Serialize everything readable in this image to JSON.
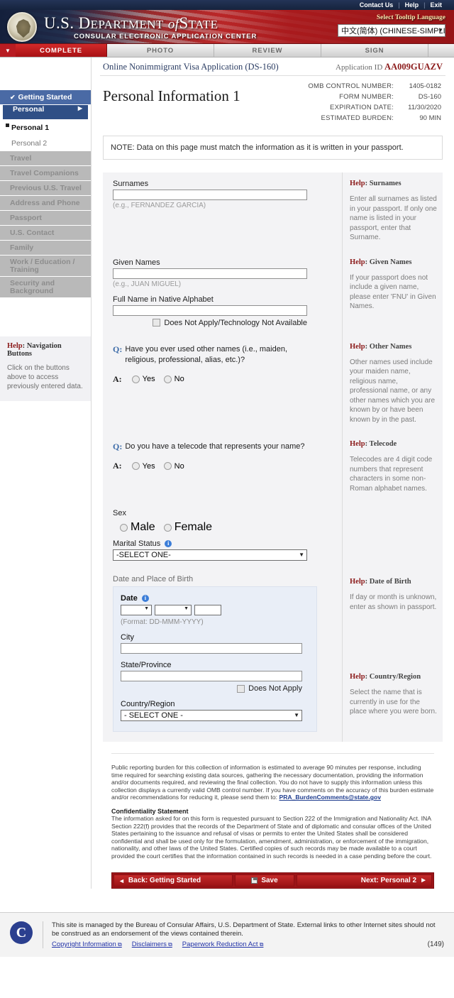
{
  "utility_bar": {
    "links": [
      "Contact Us",
      "Help",
      "Exit"
    ]
  },
  "masthead": {
    "title_us": "U.S. D",
    "title_epartment": "EPARTMENT",
    "title_of": "of",
    "title_s": "S",
    "title_tate": "TATE",
    "subtitle": "CONSULAR ELECTRONIC APPLICATION CENTER",
    "tooltip_language_label": "Select Tooltip Language",
    "tooltip_language_value": "中文(简体)  (CHINESE-SIMPLI",
    "seal_icon": "department-of-state-seal"
  },
  "tabs": [
    {
      "label": "COMPLETE",
      "state": "active"
    },
    {
      "label": "PHOTO",
      "state": "inactive"
    },
    {
      "label": "REVIEW",
      "state": "inactive"
    },
    {
      "label": "SIGN",
      "state": "inactive"
    }
  ],
  "sidebar": {
    "items": [
      {
        "label": "Getting Started",
        "type": "completed",
        "check": "✔"
      },
      {
        "label": "Personal",
        "type": "section",
        "caret": "▶"
      },
      {
        "label": "Personal 1",
        "type": "subitem-current"
      },
      {
        "label": "Personal 2",
        "type": "subitem"
      },
      {
        "label": "Travel",
        "type": "disabled"
      },
      {
        "label": "Travel Companions",
        "type": "disabled"
      },
      {
        "label": "Previous U.S. Travel",
        "type": "disabled"
      },
      {
        "label": "Address and Phone",
        "type": "disabled"
      },
      {
        "label": "Passport",
        "type": "disabled"
      },
      {
        "label": "U.S. Contact",
        "type": "disabled"
      },
      {
        "label": "Family",
        "type": "disabled"
      },
      {
        "label": "Work / Education / Training",
        "type": "disabled-two-line"
      },
      {
        "label": "Security and Background",
        "type": "disabled-two-line"
      }
    ],
    "help": {
      "title_word": "Help",
      "title_rest": ": Navigation Buttons",
      "body": "Click on the buttons above to access previously entered data."
    }
  },
  "header": {
    "app_name": "Online Nonimmigrant Visa Application (DS-160)",
    "application_id_label": "Application ID",
    "application_id": "AA009GUAZV",
    "page_title": "Personal Information 1",
    "omb": [
      {
        "label": "OMB CONTROL NUMBER:",
        "value": "1405-0182"
      },
      {
        "label": "FORM NUMBER:",
        "value": "DS-160"
      },
      {
        "label": "EXPIRATION DATE:",
        "value": "11/30/2020"
      },
      {
        "label": "ESTIMATED BURDEN:",
        "value": "90 MIN"
      }
    ]
  },
  "note": "NOTE: Data on this page must match the information as it is written in your passport.",
  "form": {
    "surnames": {
      "label": "Surnames",
      "value": "",
      "hint": "(e.g., FERNANDEZ GARCIA)",
      "help_title_word": "Help",
      "help_title_rest": ": Surnames",
      "help_text": "Enter all surnames as listed in your passport. If only one name is listed in your passport, enter that Surname."
    },
    "given_names": {
      "label": "Given Names",
      "value": "",
      "hint": "(e.g., JUAN MIGUEL)",
      "help_title_word": "Help",
      "help_title_rest": ": Given Names",
      "help_text": "If your passport does not include a given name, please enter 'FNU' in Given Names."
    },
    "native_alphabet": {
      "label": "Full Name in Native Alphabet",
      "value": "",
      "checkbox_label": "Does Not Apply/Technology Not Available",
      "checked": false
    },
    "other_names": {
      "q_mark": "Q",
      "a_mark": "A",
      "question": "Have you ever used other names (i.e., maiden, religious, professional, alias, etc.)?",
      "options": [
        "Yes",
        "No"
      ],
      "selected": "",
      "help_title_word": "Help",
      "help_title_rest": ": Other Names",
      "help_text": "Other names used include your maiden name, religious name, professional name, or any other names which you are known by or have been known by in the past."
    },
    "telecode": {
      "q_mark": "Q",
      "a_mark": "A",
      "question": "Do you have a telecode that represents your name?",
      "options": [
        "Yes",
        "No"
      ],
      "selected": "",
      "help_title_word": "Help",
      "help_title_rest": ": Telecode",
      "help_text": "Telecodes are 4 digit code numbers that represent characters in some non-Roman alphabet names."
    },
    "sex": {
      "label": "Sex",
      "options": [
        "Male",
        "Female"
      ],
      "selected": ""
    },
    "marital_status": {
      "label": "Marital Status",
      "value": "-SELECT ONE-",
      "info_icon": "info-icon"
    },
    "dob_section": {
      "header": "Date and Place of Birth",
      "date_label": "Date",
      "day_value": "",
      "month_value": "",
      "year_value": "",
      "format_hint": "(Format: DD-MMM-YYYY)",
      "city_label": "City",
      "city_value": "",
      "state_label": "State/Province",
      "state_value": "",
      "does_not_apply_label": "Does Not Apply",
      "does_not_apply_checked": false,
      "country_label": "Country/Region",
      "country_value": "- SELECT ONE -",
      "help_dob_title_word": "Help",
      "help_dob_title_rest": ": Date of Birth",
      "help_dob_text": "If day or month is unknown, enter as shown in passport.",
      "help_country_title_word": "Help",
      "help_country_title_rest": ": Country/Region",
      "help_country_text": "Select the name that is currently in use for the place where you were born."
    }
  },
  "fineprint": {
    "burden": "Public reporting burden for this collection of information is estimated to average 90 minutes per response, including time required for searching existing data sources, gathering the necessary documentation, providing the information and/or documents required, and reviewing the final collection. You do not have to supply this information unless this collection displays a currently valid OMB control number. If you have comments on the accuracy of this burden estimate and/or recommendations for reducing it, please send them to: ",
    "burden_email": "PRA_BurdenComments@state.gov",
    "confidentiality_title": "Confidentiality Statement",
    "confidentiality_body": "The information asked for on this form is requested pursuant to Section 222 of the Immigration and Nationality Act. INA Section 222(f) provides that the records of the Department of State and of diplomatic and consular offices of the United States pertaining to the issuance and refusal of visas or permits to enter the United States shall be considered confidential and shall be used only for the formulation, amendment, administration, or enforcement of the immigration, nationality, and other laws of the United States. Certified copies of such records may be made available to a court provided the court certifies that the information contained in such records is needed in a case pending before the court."
  },
  "buttons": {
    "back": "Back: Getting Started",
    "back_arrow": "◄",
    "save": "Save",
    "save_icon": "save-disk-icon",
    "next": "Next: Personal 2",
    "next_arrow": "►"
  },
  "footer": {
    "seal_icon": "consular-affairs-seal",
    "text": "This site is managed by the Bureau of Consular Affairs, U.S. Department of State. External links to other Internet sites should not be construed as an endorsement of the views contained therein.",
    "links": [
      "Copyright Information",
      "Disclaimers",
      "Paperwork Reduction Act"
    ],
    "external_icon": "external-link-icon",
    "count": "(149)"
  },
  "colors": {
    "brand_red": "#a81114",
    "navy": "#16233d",
    "section_blue": "#2f4f86",
    "help_red": "#8b1a1a"
  }
}
